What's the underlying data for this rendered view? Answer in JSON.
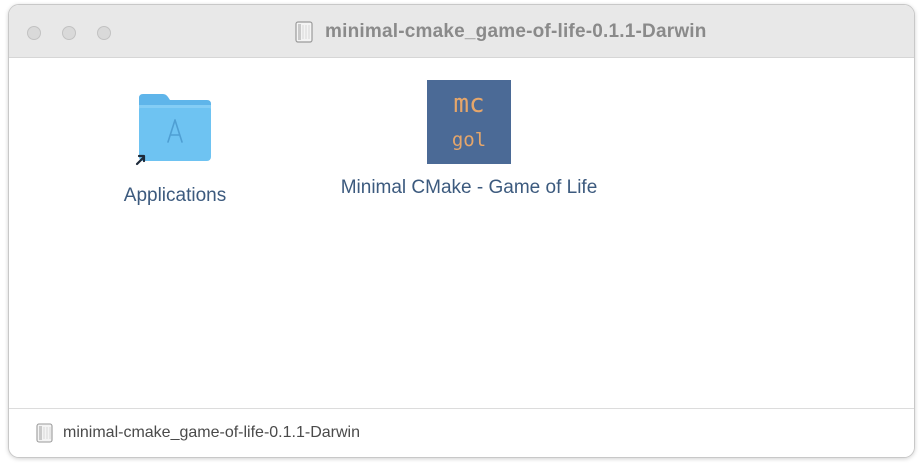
{
  "window": {
    "title": "minimal-cmake_game-of-life-0.1.1-Darwin",
    "title_icon": "disk-image-icon"
  },
  "items": [
    {
      "label": "Applications",
      "icon": "applications-folder-icon"
    },
    {
      "label": "Minimal CMake - Game of Life",
      "icon": "app-icon",
      "icon_text_top": "mc",
      "icon_text_bottom": "gol"
    }
  ],
  "statusbar": {
    "path": "minimal-cmake_game-of-life-0.1.1-Darwin",
    "icon": "disk-image-icon"
  },
  "colors": {
    "folder_blue": "#6ec3f2",
    "app_icon_bg": "#4b6a96",
    "app_icon_text": "#e6a66a",
    "label_text": "#3c5a7e"
  }
}
